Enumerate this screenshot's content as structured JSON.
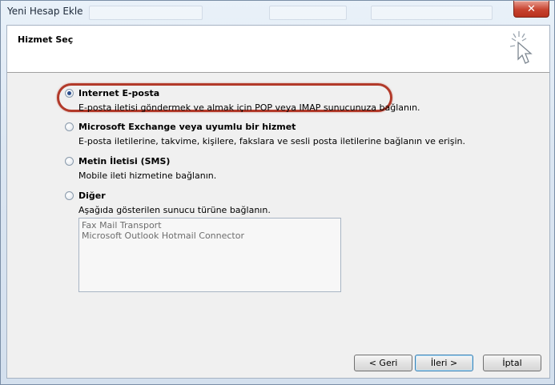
{
  "window": {
    "title": "Yeni Hesap Ekle",
    "close_label": "✕"
  },
  "header": {
    "title": "Hizmet Seç",
    "icon": "wizard-cursor-icon"
  },
  "options": [
    {
      "label": "Internet E-posta",
      "description": "E-posta iletisi göndermek ve almak için POP veya IMAP sunucunuza bağlanın.",
      "checked": true
    },
    {
      "label": "Microsoft Exchange veya uyumlu bir hizmet",
      "description": "E-posta iletilerine, takvime, kişilere, fakslara ve sesli posta iletilerine bağlanın ve erişin.",
      "checked": false
    },
    {
      "label": "Metin İletisi (SMS)",
      "description": "Mobile ileti hizmetine bağlanın.",
      "checked": false
    },
    {
      "label": "Diğer",
      "description": "Aşağıda gösterilen sunucu türüne bağlanın.",
      "checked": false
    }
  ],
  "server_list": [
    "Fax Mail Transport",
    "Microsoft Outlook Hotmail Connector"
  ],
  "buttons": {
    "back": "< Geri",
    "next": "İleri >",
    "cancel": "İptal"
  },
  "colors": {
    "highlight": "#b23a2a",
    "close": "#c7432f"
  }
}
